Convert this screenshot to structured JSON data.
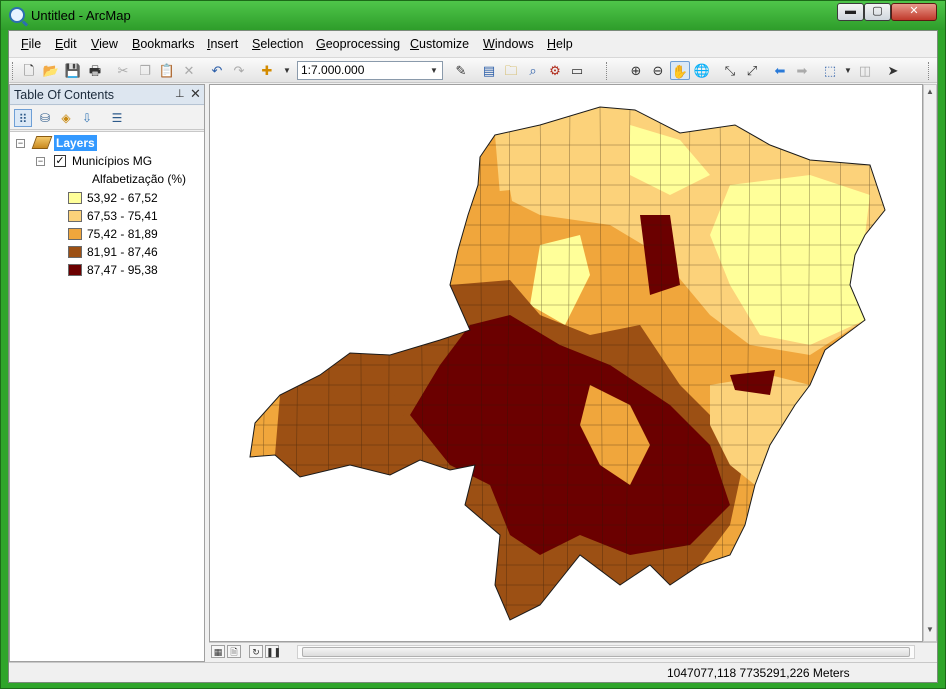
{
  "window": {
    "title": "Untitled - ArcMap",
    "controls": {
      "minimize": "▬",
      "maximize": "▢",
      "close": "✕"
    }
  },
  "menu": [
    {
      "label": "File",
      "key": "F"
    },
    {
      "label": "Edit",
      "key": "E"
    },
    {
      "label": "View",
      "key": "V"
    },
    {
      "label": "Bookmarks",
      "key": "B"
    },
    {
      "label": "Insert",
      "key": "I"
    },
    {
      "label": "Selection",
      "key": "S"
    },
    {
      "label": "Geoprocessing",
      "key": "G"
    },
    {
      "label": "Customize",
      "key": "C"
    },
    {
      "label": "Windows",
      "key": "W"
    },
    {
      "label": "Help",
      "key": "H"
    }
  ],
  "toolbar": {
    "scale": "1:7.000.000",
    "icons": [
      "new-icon",
      "open-icon",
      "save-icon",
      "print-icon",
      "cut-icon",
      "copy-icon",
      "paste-icon",
      "delete-icon",
      "undo-icon",
      "redo-icon",
      "add-data-icon",
      "editor-icon",
      "table-icon",
      "catalog-icon",
      "search-icon",
      "model-icon",
      "python-icon",
      "zoom-in-icon",
      "zoom-out-icon",
      "pan-icon",
      "full-extent-icon",
      "fixed-zoom-in-icon",
      "fixed-zoom-out-icon",
      "back-icon",
      "forward-icon",
      "select-features-icon",
      "clear-selection-icon",
      "select-elements-icon"
    ]
  },
  "toc": {
    "title": "Table Of Contents",
    "pin": "✔",
    "close": "✕",
    "root": "Layers",
    "layer": {
      "name": "Municípios MG",
      "checked": true,
      "field": "Alfabetização (%)"
    },
    "legend": [
      {
        "label": "53,92 - 67,52",
        "color": "#ffff99"
      },
      {
        "label": "67,53 - 75,41",
        "color": "#fcd27a"
      },
      {
        "label": "75,42 - 81,89",
        "color": "#f0a63c"
      },
      {
        "label": "81,91 - 87,46",
        "color": "#9c5014"
      },
      {
        "label": "87,47 - 95,38",
        "color": "#6b0000"
      }
    ]
  },
  "status": {
    "coordinates": "1047077,118  7735291,226 Meters"
  }
}
